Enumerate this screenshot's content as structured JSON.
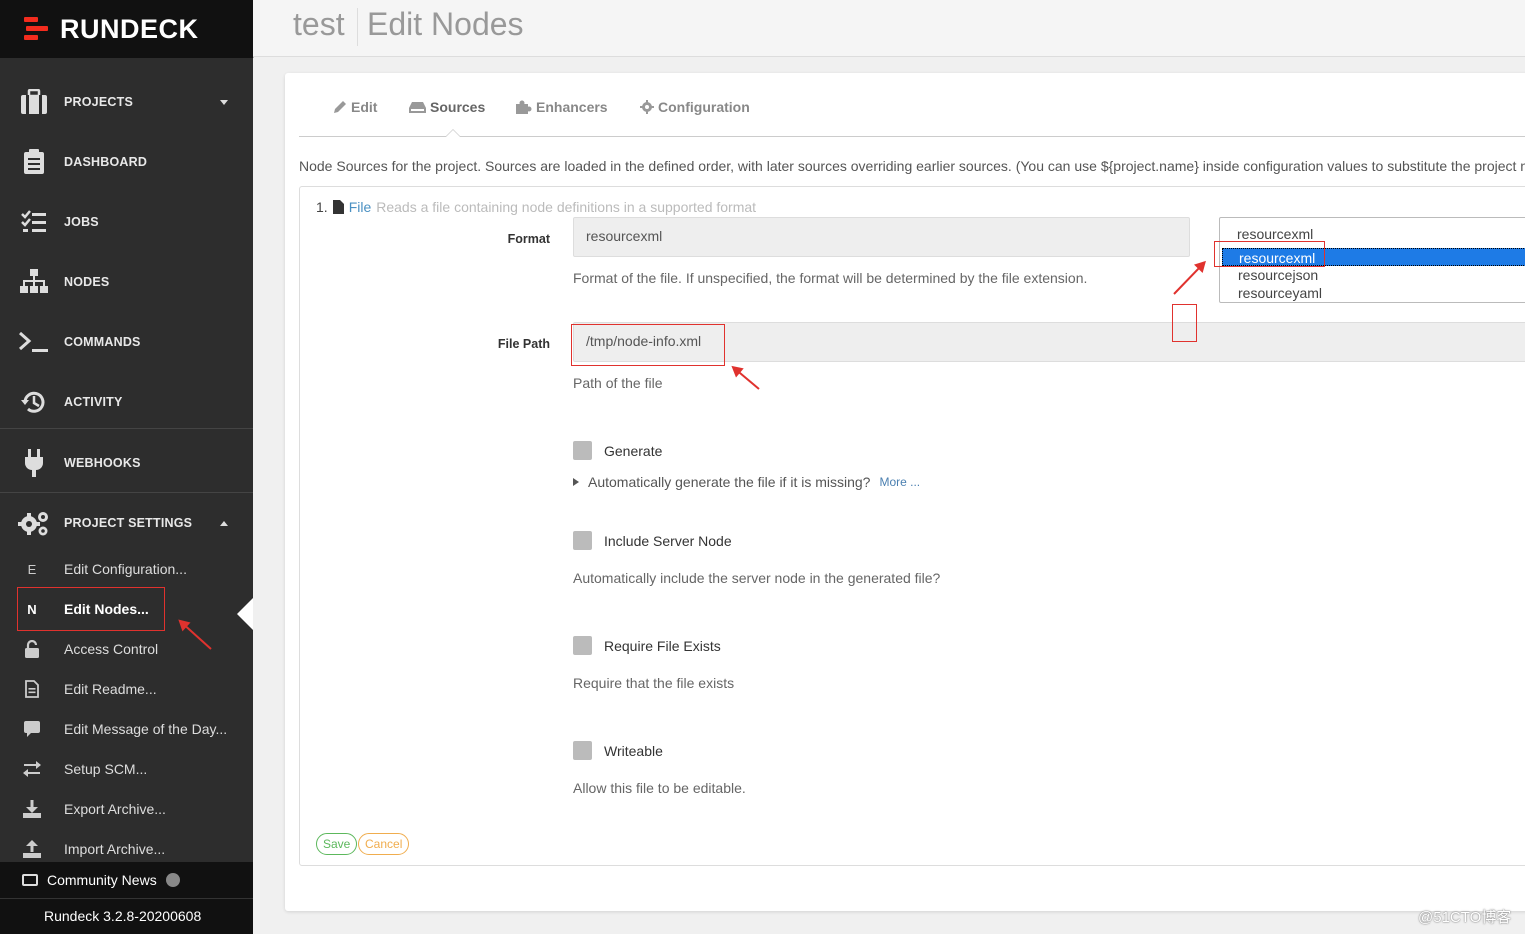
{
  "brand": {
    "name": "RUNDECK"
  },
  "header": {
    "project": "test",
    "title": "Edit Nodes"
  },
  "nav": [
    {
      "label": "PROJECTS",
      "icon": "briefcase-icon"
    },
    {
      "label": "DASHBOARD",
      "icon": "clipboard-icon"
    },
    {
      "label": "JOBS",
      "icon": "tasks-icon"
    },
    {
      "label": "NODES",
      "icon": "sitemap-icon"
    },
    {
      "label": "COMMANDS",
      "icon": "terminal-icon"
    },
    {
      "label": "ACTIVITY",
      "icon": "history-icon"
    },
    {
      "label": "WEBHOOKS",
      "icon": "plug-icon"
    },
    {
      "label": "PROJECT SETTINGS",
      "icon": "gears-icon"
    }
  ],
  "settings_items": [
    {
      "label": "Edit Configuration...",
      "glyph": "E"
    },
    {
      "label": "Edit Nodes...",
      "glyph": "N"
    },
    {
      "label": "Access Control",
      "icon": "lock-icon"
    },
    {
      "label": "Edit Readme...",
      "icon": "file-icon"
    },
    {
      "label": "Edit Message of the Day...",
      "icon": "comment-icon"
    },
    {
      "label": "Setup SCM...",
      "icon": "exchange-icon"
    },
    {
      "label": "Export Archive...",
      "icon": "download-icon"
    },
    {
      "label": "Import Archive...",
      "icon": "upload-icon"
    }
  ],
  "footer": {
    "community": "Community News",
    "version": "Rundeck 3.2.8-20200608"
  },
  "tabs": [
    {
      "label": "Edit",
      "icon": "pencil-icon"
    },
    {
      "label": "Sources",
      "icon": "hdd-icon"
    },
    {
      "label": "Enhancers",
      "icon": "puzzle-icon"
    },
    {
      "label": "Configuration",
      "icon": "cog-icon"
    }
  ],
  "intro": "Node Sources for the project. Sources are loaded in the defined order, with later sources overriding earlier sources. (You can use ${project.name} inside configuration values to substitute the project n",
  "source": {
    "index": "1.",
    "type": "File",
    "description": "Reads a file containing node definitions in a supported format",
    "format": {
      "label": "Format",
      "value": "resourcexml",
      "help": "Format of the file. If unspecified, the format will be determined by the file extension.",
      "options": [
        "resourcexml",
        "resourcejson",
        "resourceyaml"
      ]
    },
    "file_path": {
      "label": "File Path",
      "value": "/tmp/node-info.xml",
      "help": "Path of the file"
    },
    "generate": {
      "label": "Generate",
      "help": "Automatically generate the file if it is missing?",
      "more": "More ..."
    },
    "include_server": {
      "label": "Include Server Node",
      "help": "Automatically include the server node in the generated file?"
    },
    "require_exists": {
      "label": "Require File Exists",
      "help": "Require that the file exists"
    },
    "writeable": {
      "label": "Writeable",
      "help": "Allow this file to be editable."
    }
  },
  "buttons": {
    "save": "Save",
    "cancel": "Cancel"
  },
  "watermark": "@51CTO博客",
  "colors": {
    "brand_red": "#f32c1e",
    "sidebar_bg": "#2d2d2d",
    "annotation_red": "#e0322e",
    "select_blue": "#1e7be6"
  }
}
